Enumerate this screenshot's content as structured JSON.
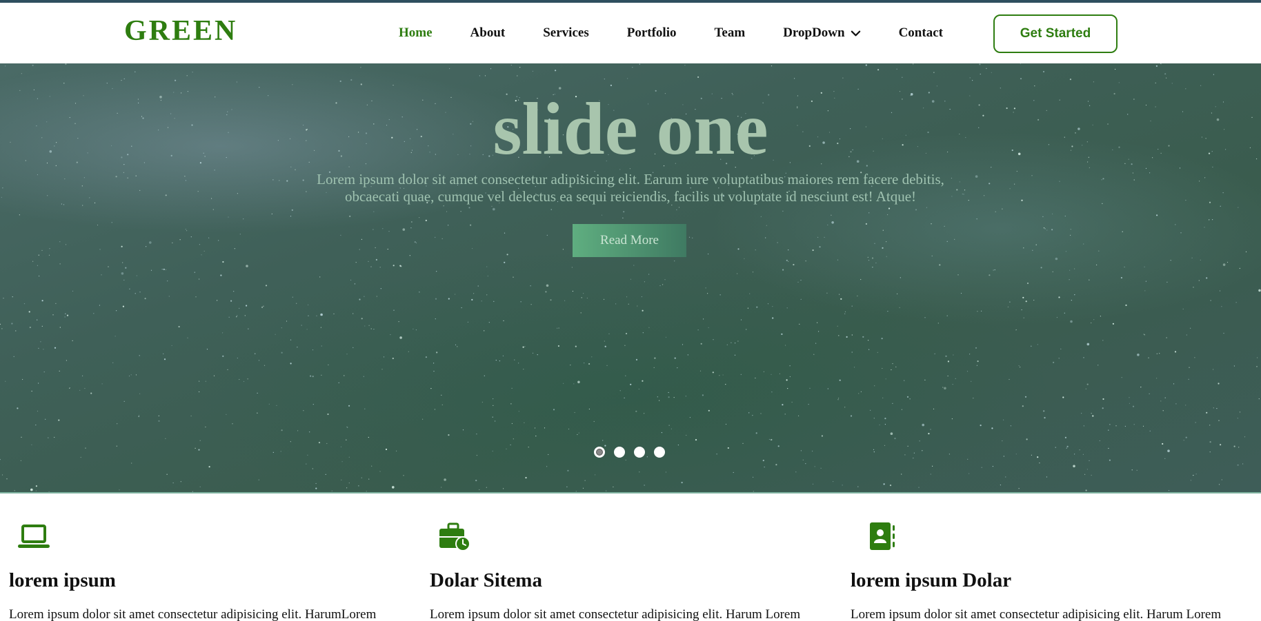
{
  "brand": {
    "logo": "GREEN",
    "accent": "#2e7d10"
  },
  "nav": {
    "items": [
      {
        "label": "Home",
        "active": true
      },
      {
        "label": "About"
      },
      {
        "label": "Services"
      },
      {
        "label": "Portfolio"
      },
      {
        "label": "Team"
      },
      {
        "label": "DropDown",
        "icon": "chevron-down-icon"
      },
      {
        "label": "Contact"
      }
    ],
    "cta": "Get Started"
  },
  "hero": {
    "title": "slide one",
    "text_line1": "Lorem ipsum dolor sit amet consectetur adipisicing elit. Earum iure voluptatibus maiores rem facere debitis,",
    "text_line2": "obcaecati quae, cumque vel delectus ea sequi reiciendis, facilis ut voluptate id nesciunt est! Atque!",
    "button": "Read More",
    "slides": {
      "count": 4,
      "active": 1
    }
  },
  "features": [
    {
      "icon": "laptop-icon",
      "title": "lorem ipsum",
      "text": "Lorem ipsum dolor sit amet consectetur adipisicing elit. HarumLorem"
    },
    {
      "icon": "briefcase-clock-icon",
      "title": "Dolar Sitema",
      "text": "Lorem ipsum dolor sit amet consectetur adipisicing elit. Harum Lorem"
    },
    {
      "icon": "contact-book-icon",
      "title": "lorem ipsum Dolar",
      "text": "Lorem ipsum dolor sit amet consectetur adipisicing elit. Harum Lorem"
    }
  ]
}
